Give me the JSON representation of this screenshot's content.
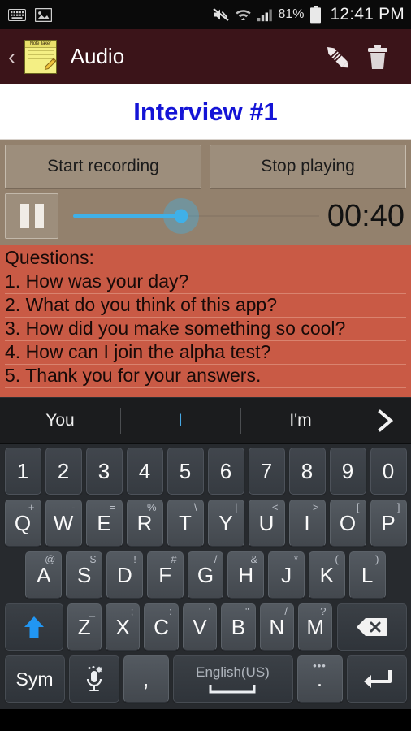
{
  "status_bar": {
    "left_icons": [
      "keyboard-icon",
      "image-icon"
    ],
    "right_icons": [
      "mute-icon",
      "wifi-icon",
      "signal-icon",
      "battery-icon"
    ],
    "battery_percent": "81%",
    "time": "12:41 PM"
  },
  "app_bar": {
    "back_label": "‹",
    "app_icon_label": "Note Taker",
    "title": "Audio",
    "edit_icon": "pencil-icon",
    "delete_icon": "trash-icon"
  },
  "recording": {
    "title": "Interview #1",
    "start_button": "Start recording",
    "stop_button": "Stop playing",
    "pause_button": "pause-icon",
    "elapsed_time": "00:40",
    "seek_percent": 44
  },
  "notes": {
    "lines": [
      "Questions:",
      "1. How was your day?",
      "2. What do you think of this app?",
      "3. How did you make something so cool?",
      "4. How can I join the alpha test?",
      "5. Thank you for your answers."
    ]
  },
  "keyboard": {
    "suggestions": [
      {
        "text": "You",
        "active": false
      },
      {
        "text": "I",
        "active": true
      },
      {
        "text": "I'm",
        "active": false
      }
    ],
    "expand_icon": "chevron-right-icon",
    "row_numbers": [
      "1",
      "2",
      "3",
      "4",
      "5",
      "6",
      "7",
      "8",
      "9",
      "0"
    ],
    "row_top": [
      {
        "key": "Q",
        "sup": "+"
      },
      {
        "key": "W",
        "sup": "-"
      },
      {
        "key": "E",
        "sup": "="
      },
      {
        "key": "R",
        "sup": "%"
      },
      {
        "key": "T",
        "sup": "\\"
      },
      {
        "key": "Y",
        "sup": "|"
      },
      {
        "key": "U",
        "sup": "<"
      },
      {
        "key": "I",
        "sup": ">"
      },
      {
        "key": "O",
        "sup": "["
      },
      {
        "key": "P",
        "sup": "]"
      }
    ],
    "row_home": [
      {
        "key": "A",
        "sup": "@"
      },
      {
        "key": "S",
        "sup": "$"
      },
      {
        "key": "D",
        "sup": "!"
      },
      {
        "key": "F",
        "sup": "#"
      },
      {
        "key": "G",
        "sup": "/"
      },
      {
        "key": "H",
        "sup": "&"
      },
      {
        "key": "J",
        "sup": "*"
      },
      {
        "key": "K",
        "sup": "("
      },
      {
        "key": "L",
        "sup": ")"
      }
    ],
    "row_bottom": [
      {
        "key": "Z",
        "sup": "_"
      },
      {
        "key": "X",
        "sup": ";"
      },
      {
        "key": "C",
        "sup": ":"
      },
      {
        "key": "V",
        "sup": "'"
      },
      {
        "key": "B",
        "sup": "\""
      },
      {
        "key": "N",
        "sup": "/"
      },
      {
        "key": "M",
        "sup": "?"
      }
    ],
    "shift_icon": "shift-arrow-icon",
    "backspace_icon": "backspace-icon",
    "sym_label": "Sym",
    "mic_icon": "microphone-settings-icon",
    "comma_label": ",",
    "space_label": "English(US)",
    "period_label": ".",
    "period_sup": "•••",
    "enter_icon": "enter-icon"
  },
  "colors": {
    "appbar": "#3b1419",
    "title_text": "#1414d6",
    "controls_bg": "#93816d",
    "notes_bg": "#c95a45",
    "seek_accent": "#3fb0e8",
    "shift_accent": "#2196f3"
  }
}
